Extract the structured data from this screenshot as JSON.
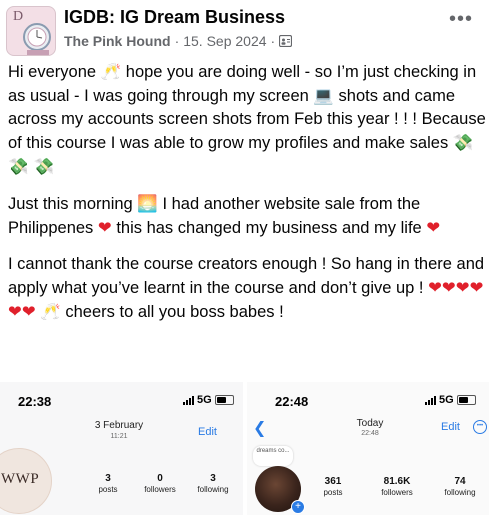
{
  "post": {
    "group_name": "IGDB: IG Dream Business",
    "author": "The Pink Hound",
    "date": "15. Sep 2024",
    "separator": "·",
    "paragraphs": [
      [
        {
          "t": "Hi everyone "
        },
        {
          "e": "🥂"
        },
        {
          "t": " hope you are doing well - so I’m just checking in as usual - I was going through my screen "
        },
        {
          "e": "💻"
        },
        {
          "t": " shots and came across my accounts screen shots from Feb this year ! ! ! Because of this course I was able to grow my profiles and make sales "
        },
        {
          "e": "💸 💸 💸"
        }
      ],
      [
        {
          "t": "Just this morning "
        },
        {
          "e": "🌅"
        },
        {
          "t": " I had another website sale from the Philippenes "
        },
        {
          "h": "❤"
        },
        {
          "t": " this has changed my business and my life "
        },
        {
          "h": "❤"
        }
      ],
      [
        {
          "t": "I cannot thank the course creators enough ! So hang in there and apply what you’ve learnt in the course and don’t give up ! "
        },
        {
          "h": "❤❤❤❤❤❤"
        },
        {
          "t": " "
        },
        {
          "e": "🥂"
        },
        {
          "t": " cheers to all you boss babes !"
        }
      ]
    ]
  },
  "screenshot_left": {
    "time": "22:38",
    "network": "5G",
    "date_title": "3 February",
    "date_sub": "11:21",
    "edit_label": "Edit",
    "profile_text": "WWP",
    "stats": [
      {
        "num": "3",
        "label": "posts"
      },
      {
        "num": "0",
        "label": "followers"
      },
      {
        "num": "3",
        "label": "following"
      }
    ]
  },
  "screenshot_right": {
    "time": "22:48",
    "network": "5G",
    "date_title": "Today",
    "date_sub": "22:48",
    "edit_label": "Edit",
    "note_text": "dreams co...",
    "stats": [
      {
        "num": "361",
        "label": "posts"
      },
      {
        "num": "81.6K",
        "label": "followers"
      },
      {
        "num": "74",
        "label": "following"
      }
    ]
  },
  "colors": {
    "link_blue": "#2a7be4",
    "heart_red": "#e0202b",
    "meta_grey": "#65676b"
  }
}
